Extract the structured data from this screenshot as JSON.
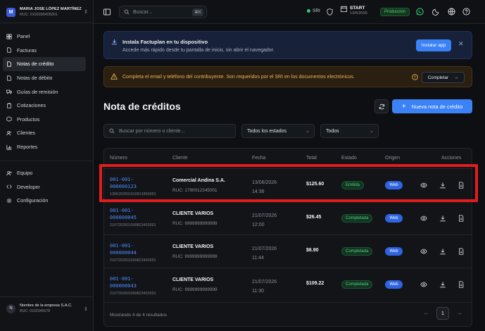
{
  "brand": {
    "initial": "M",
    "name": "MARIA JOSE LÓPEZ MARTÍNEZ",
    "ruc": "RUC: 0102030405001"
  },
  "sidebar": {
    "items": [
      {
        "label": "Panel",
        "icon": "grid-icon"
      },
      {
        "label": "Facturas",
        "icon": "file-icon"
      },
      {
        "label": "Notas de crédito",
        "icon": "file-icon",
        "active": true
      },
      {
        "label": "Notas de débito",
        "icon": "file-icon"
      },
      {
        "label": "Guías de remisión",
        "icon": "truck-icon"
      },
      {
        "label": "Cotizaciones",
        "icon": "clipboard-icon"
      },
      {
        "label": "Productos",
        "icon": "box-icon"
      },
      {
        "label": "Clientes",
        "icon": "users-icon"
      },
      {
        "label": "Reportes",
        "icon": "chart-icon"
      }
    ],
    "items2": [
      {
        "label": "Equipo",
        "icon": "user-plus-icon"
      },
      {
        "label": "Developer",
        "icon": "code-icon"
      },
      {
        "label": "Configuración",
        "icon": "gear-icon"
      }
    ],
    "footer": {
      "initial": "N",
      "name": "Nombre de la empresa S.A.C.",
      "ruc": "RUC: 0102345678"
    }
  },
  "topbar": {
    "search_placeholder": "Buscar...",
    "shortcut": "⌘K",
    "sri_label": "SRI",
    "start_title": "START",
    "start_date": "13/6/2026",
    "env_badge": "Producción"
  },
  "install_banner": {
    "title": "Instala Factuplan en tu dispositivo",
    "subtitle": "Accede más rápido desde tu pantalla de inicio, sin abrir el navegador.",
    "button": "Instalar app",
    "close": "✕"
  },
  "warning_banner": {
    "text": "Completa el email y teléfono del contribuyente. Son requeridos por el SRI en los documentos electrónicos.",
    "button": "Completar",
    "arrow": "→"
  },
  "page": {
    "title": "Nota de créditos",
    "new_button": "Nueva nota de crédito",
    "new_plus": "+"
  },
  "filters": {
    "search_placeholder": "Buscar por número o cliente...",
    "status": "Todos los estados",
    "origin": "Todos"
  },
  "table": {
    "headers": [
      "Número",
      "Cliente",
      "Fecha",
      "Total",
      "Estado",
      "Origen",
      "Acciones"
    ],
    "rows": [
      {
        "num1": "001-001-",
        "num2": "000000123",
        "access": "1306202601010913450001",
        "client": "Comercial Andina S.A.",
        "ruc": "RUC: 1790012345001",
        "date": "13/06/2026",
        "time": "14:36",
        "total": "$125.60",
        "status": "Emitida",
        "origin": "Web"
      },
      {
        "num1": "001-001-",
        "num2": "000000045",
        "access": "2107202601099823450001",
        "client": "CLIENTE VARIOS",
        "ruc": "RUC: 9999999999999",
        "date": "21/07/2026",
        "time": "12:00",
        "total": "$26.45",
        "status": "Completada",
        "origin": "Web"
      },
      {
        "num1": "001-001-",
        "num2": "000000044",
        "access": "2107202601099823450001",
        "client": "CLIENTE VARIOS",
        "ruc": "RUC: 9999999999999",
        "date": "21/07/2026",
        "time": "11:44",
        "total": "$6.90",
        "status": "Completada",
        "origin": "Web"
      },
      {
        "num1": "001-001-",
        "num2": "000000043",
        "access": "2107202601099823450001",
        "client": "CLIENTE VARIOS",
        "ruc": "RUC: 9999999999999",
        "date": "21/07/2026",
        "time": "11:30",
        "total": "$109.22",
        "status": "Completada",
        "origin": "Web"
      }
    ],
    "footer": "Mostrando 4 de 4 resultados",
    "page": "1",
    "prev": "←",
    "next": "→"
  },
  "colors": {
    "accent": "#3b82f6",
    "success": "#52d17a",
    "warning": "#e8b559",
    "highlight": "#e11d1d"
  }
}
